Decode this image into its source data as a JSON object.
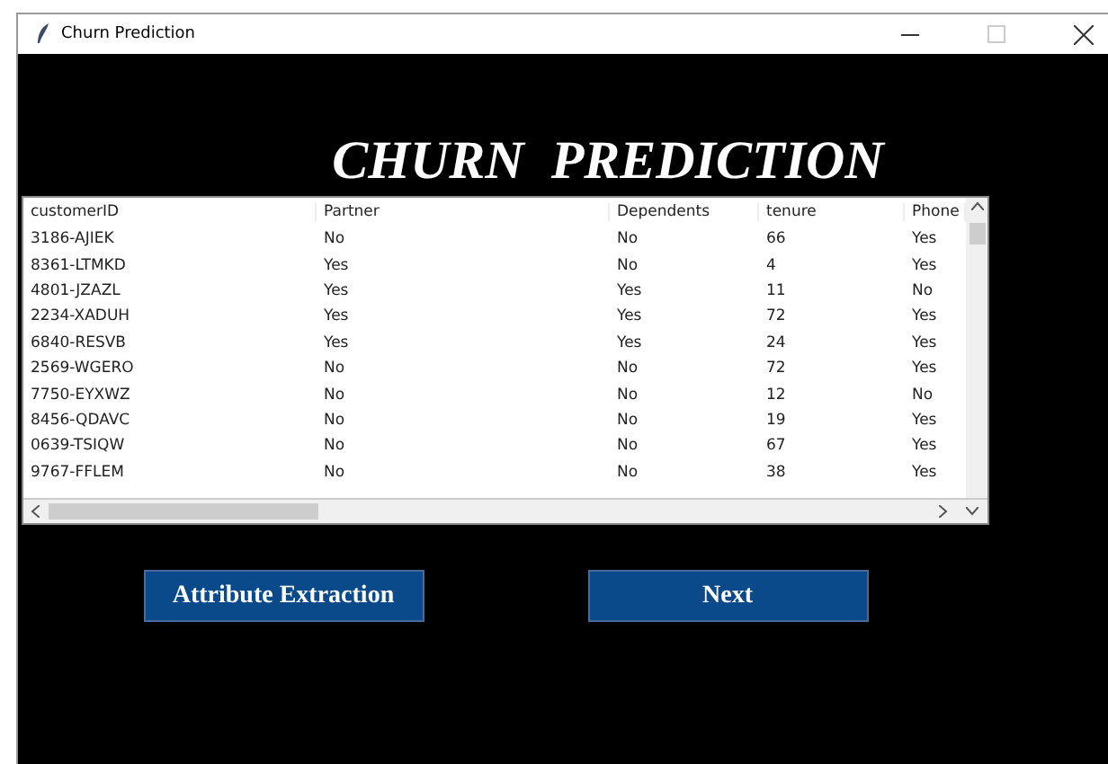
{
  "window": {
    "title": "Churn Prediction"
  },
  "heading": "CHURN  PREDICTION",
  "table": {
    "columns": [
      "customerID",
      "Partner",
      "Dependents",
      "tenure",
      "Phone"
    ],
    "rows": [
      [
        "3186-AJIEK",
        "No",
        "No",
        "66",
        "Yes"
      ],
      [
        "8361-LTMKD",
        "Yes",
        "No",
        "4",
        "Yes"
      ],
      [
        "4801-JZAZL",
        "Yes",
        "Yes",
        "11",
        "No"
      ],
      [
        "2234-XADUH",
        "Yes",
        "Yes",
        "72",
        "Yes"
      ],
      [
        "6840-RESVB",
        "Yes",
        "Yes",
        "24",
        "Yes"
      ],
      [
        "2569-WGERO",
        "No",
        "No",
        "72",
        "Yes"
      ],
      [
        "7750-EYXWZ",
        "No",
        "No",
        "12",
        "No"
      ],
      [
        "8456-QDAVC",
        "No",
        "No",
        "19",
        "Yes"
      ],
      [
        "0639-TSIQW",
        "No",
        "No",
        "67",
        "Yes"
      ],
      [
        "9767-FFLEM",
        "No",
        "No",
        "38",
        "Yes"
      ]
    ]
  },
  "buttons": [
    "Attribute Extraction",
    "Next"
  ]
}
